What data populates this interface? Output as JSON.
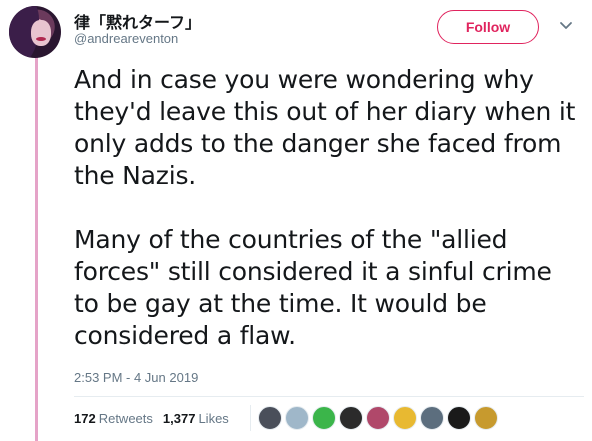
{
  "user": {
    "display_name": "律「黙れターフ」",
    "handle": "@andreareventon"
  },
  "actions": {
    "follow_label": "Follow",
    "menu_icon": "chevron-down-icon"
  },
  "tweet": {
    "paragraphs": [
      "And in case you were wondering why they'd leave this out of her diary when it only adds to the danger she faced from the Nazis.",
      "Many of the countries of the \"allied forces\" still considered it a sinful crime to be gay at the time. It would be considered a flaw."
    ],
    "timestamp": "2:53 PM - 4 Jun 2019"
  },
  "stats": {
    "retweets_count": "172",
    "retweets_label": "Retweets",
    "likes_count": "1,377",
    "likes_label": "Likes"
  },
  "likers": [
    {
      "color": "#4a4f5a"
    },
    {
      "color": "#9fb7c9"
    },
    {
      "color": "#3bb54a"
    },
    {
      "color": "#2b2b2b"
    },
    {
      "color": "#b0486a"
    },
    {
      "color": "#e8b931"
    },
    {
      "color": "#5c6e7e"
    },
    {
      "color": "#1a1a1a"
    },
    {
      "color": "#c79a2e"
    }
  ],
  "colors": {
    "accent": "#e0245e",
    "thread_line": "#e5a3c8",
    "muted_text": "#657786"
  }
}
